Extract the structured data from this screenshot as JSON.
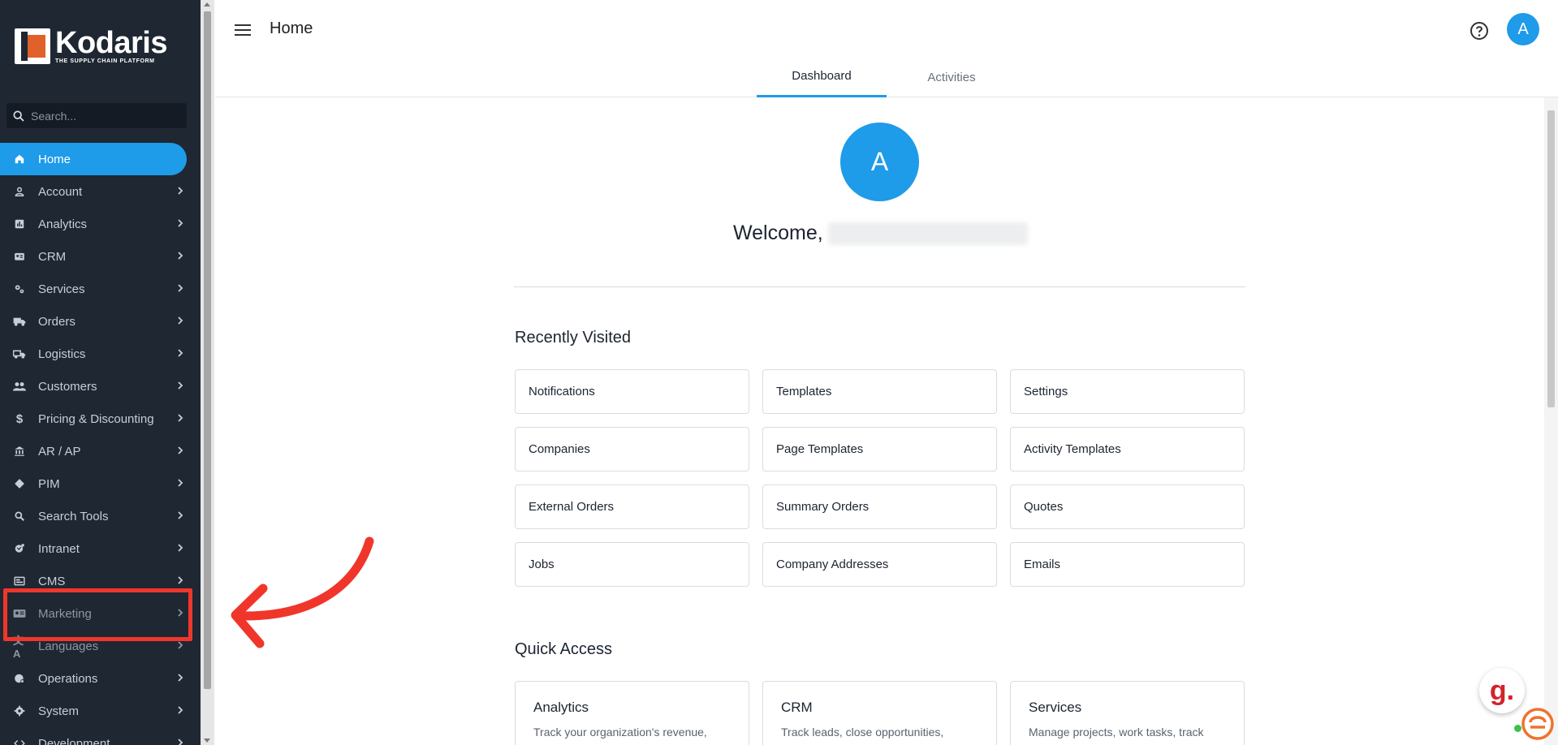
{
  "app": {
    "brand": "Kodaris",
    "tagline": "THE SUPPLY CHAIN PLATFORM"
  },
  "sidebar": {
    "search_placeholder": "Search...",
    "items": [
      {
        "label": "Home",
        "icon": "home-icon",
        "active": true
      },
      {
        "label": "Account",
        "icon": "person-icon"
      },
      {
        "label": "Analytics",
        "icon": "analytics-icon"
      },
      {
        "label": "CRM",
        "icon": "crm-icon"
      },
      {
        "label": "Services",
        "icon": "gears-icon"
      },
      {
        "label": "Orders",
        "icon": "truck-icon"
      },
      {
        "label": "Logistics",
        "icon": "shipping-icon"
      },
      {
        "label": "Customers",
        "icon": "people-icon"
      },
      {
        "label": "Pricing & Discounting",
        "icon": "dollar-icon"
      },
      {
        "label": "AR / AP",
        "icon": "bank-icon"
      },
      {
        "label": "PIM",
        "icon": "tag-icon"
      },
      {
        "label": "Search Tools",
        "icon": "search-icon"
      },
      {
        "label": "Intranet",
        "icon": "intranet-icon"
      },
      {
        "label": "CMS",
        "icon": "cms-icon"
      },
      {
        "label": "Marketing",
        "icon": "marketing-icon"
      },
      {
        "label": "Languages",
        "icon": "translate-icon"
      },
      {
        "label": "Operations",
        "icon": "operations-icon"
      },
      {
        "label": "System",
        "icon": "gear-icon"
      },
      {
        "label": "Development",
        "icon": "code-icon"
      }
    ]
  },
  "header": {
    "title": "Home",
    "avatar_letter": "A",
    "tabs": [
      {
        "label": "Dashboard",
        "active": true
      },
      {
        "label": "Activities",
        "active": false
      }
    ]
  },
  "main": {
    "avatar_letter": "A",
    "welcome": "Welcome,",
    "recently_visited_title": "Recently Visited",
    "recently_visited": [
      "Notifications",
      "Templates",
      "Settings",
      "Companies",
      "Page Templates",
      "Activity Templates",
      "External Orders",
      "Summary Orders",
      "Quotes",
      "Jobs",
      "Company Addresses",
      "Emails"
    ],
    "quick_access_title": "Quick Access",
    "quick_access": [
      {
        "title": "Analytics",
        "desc": "Track your organization's revenue,"
      },
      {
        "title": "CRM",
        "desc": "Track leads, close opportunities,"
      },
      {
        "title": "Services",
        "desc": "Manage projects, work tasks, track"
      }
    ]
  },
  "widgets": {
    "g_badge": "g."
  },
  "colors": {
    "sidebar_bg": "#1f2733",
    "accent": "#1e9be9",
    "highlight": "#f0362b",
    "brand_orange": "#e0622a"
  }
}
